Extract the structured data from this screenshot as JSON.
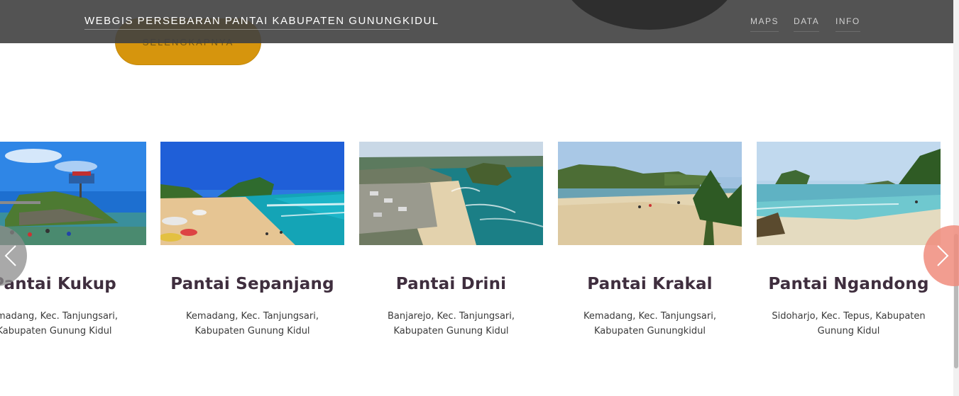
{
  "navbar": {
    "brand": "WEBGIS PERSEBARAN PANTAI KABUPATEN GUNUNGKIDUL",
    "links": [
      {
        "label": "MAPS"
      },
      {
        "label": "DATA"
      },
      {
        "label": "INFO"
      }
    ]
  },
  "hero": {
    "cta_label": "SELENGKAPNYA",
    "cta_color": "#d6950d"
  },
  "carousel": {
    "prev_icon": "chevron-left-icon",
    "next_icon": "chevron-right-icon",
    "prev_color": "#8c8c8c",
    "next_color": "#f08c7d",
    "cards": [
      {
        "title": "Pantai Kukup",
        "address": [
          "emadang, Kec. Tanjungsari,",
          "Kabupaten Gunung Kidul"
        ]
      },
      {
        "title": "Pantai Sepanjang",
        "address": [
          "Kemadang, Kec. Tanjungsari,",
          "Kabupaten Gunung Kidul"
        ]
      },
      {
        "title": "Pantai Drini",
        "address": [
          "Banjarejo, Kec. Tanjungsari,",
          "Kabupaten Gunung Kidul"
        ]
      },
      {
        "title": "Pantai Krakal",
        "address": [
          "Kemadang, Kec. Tanjungsari,",
          "Kabupaten Gunungkidul"
        ]
      },
      {
        "title": "Pantai Ngandong",
        "address": [
          "Sidoharjo, Kec. Tepus, Kabupaten",
          "Gunung Kidul"
        ]
      }
    ]
  }
}
